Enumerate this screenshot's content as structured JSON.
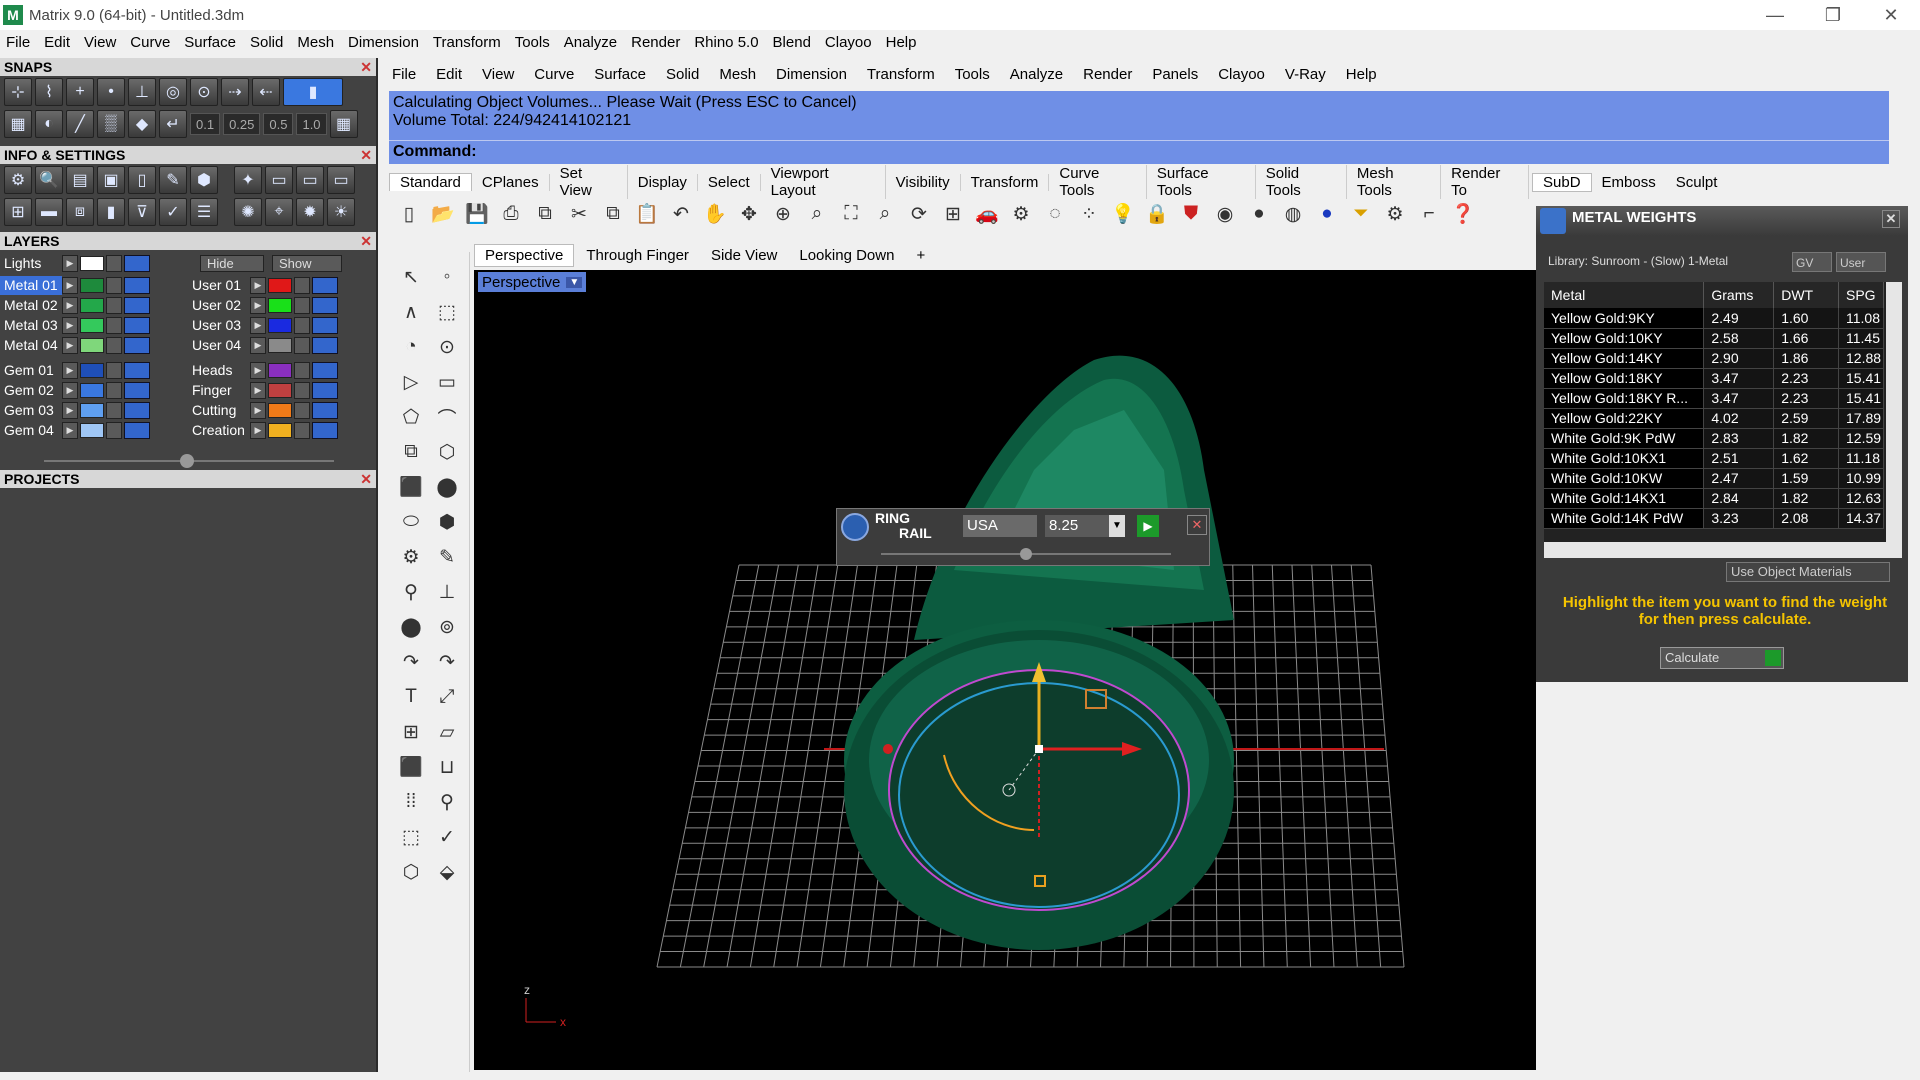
{
  "window": {
    "title": "Matrix 9.0 (64-bit) - Untitled.3dm"
  },
  "main_menu": [
    "File",
    "Edit",
    "View",
    "Curve",
    "Surface",
    "Solid",
    "Mesh",
    "Dimension",
    "Transform",
    "Tools",
    "Analyze",
    "Render",
    "Rhino 5.0",
    "Blend",
    "Clayoo",
    "Help"
  ],
  "panels": {
    "snaps": "SNAPS",
    "info": "INFO & SETTINGS",
    "layers": "LAYERS",
    "projects": "PROJECTS",
    "snap_values": [
      "0.1",
      "0.25",
      "0.5",
      "1.0"
    ]
  },
  "layers": {
    "lights_label": "Lights",
    "hide_label": "Hide",
    "show_label": "Show",
    "left": [
      {
        "name": "Metal 01",
        "color": "#1e8a3c",
        "selected": true
      },
      {
        "name": "Metal 02",
        "color": "#23a84a",
        "selected": false
      },
      {
        "name": "Metal 03",
        "color": "#34c95c",
        "selected": false
      },
      {
        "name": "Metal 04",
        "color": "#7fd77b",
        "selected": false
      },
      {
        "name": "Gem 01",
        "color": "#1f4fb8",
        "selected": false
      },
      {
        "name": "Gem 02",
        "color": "#3a78e0",
        "selected": false
      },
      {
        "name": "Gem 03",
        "color": "#5f9ff0",
        "selected": false
      },
      {
        "name": "Gem 04",
        "color": "#9fc6f5",
        "selected": false
      }
    ],
    "right": [
      {
        "name": "User 01",
        "color": "#e01818"
      },
      {
        "name": "User 02",
        "color": "#19e019"
      },
      {
        "name": "User 03",
        "color": "#1a2ae0"
      },
      {
        "name": "User 04",
        "color": "#8a8a8a"
      },
      {
        "name": "Heads",
        "color": "#8a2fc0"
      },
      {
        "name": "Finger",
        "color": "#c04040"
      },
      {
        "name": "Cutting",
        "color": "#f07a18"
      },
      {
        "name": "Creation",
        "color": "#f0b020"
      }
    ]
  },
  "rhino_menu": [
    "File",
    "Edit",
    "View",
    "Curve",
    "Surface",
    "Solid",
    "Mesh",
    "Dimension",
    "Transform",
    "Tools",
    "Analyze",
    "Render",
    "Panels",
    "Clayoo",
    "V-Ray",
    "Help"
  ],
  "command": {
    "line1": "Calculating Object Volumes... Please Wait (Press ESC to Cancel)",
    "line2": "Volume Total: 224/942414102121",
    "prompt": "Command:"
  },
  "toolbar_tabs": [
    "Standard",
    "CPlanes",
    "Set View",
    "Display",
    "Select",
    "Viewport Layout",
    "Visibility",
    "Transform",
    "Curve Tools",
    "Surface Tools",
    "Solid Tools",
    "Mesh Tools",
    "Render To"
  ],
  "viewport": {
    "tabs": [
      "Perspective",
      "Through Finger",
      "Side View",
      "Looking Down"
    ],
    "active_label": "Perspective"
  },
  "ring_rail": {
    "title_line1": "RING",
    "title_line2": "RAIL",
    "standard": "USA",
    "size": "8.25"
  },
  "right_tabs": [
    "SubD",
    "Emboss",
    "Sculpt"
  ],
  "metal_weights": {
    "title": "METAL WEIGHTS",
    "library": "Library: Sunroom - (Slow) 1-Metal",
    "gv_label": "GV",
    "user_label": "User",
    "columns": [
      "Metal",
      "Grams",
      "DWT",
      "SPG"
    ],
    "rows": [
      [
        "Yellow Gold:9KY",
        "2.49",
        "1.60",
        "11.08"
      ],
      [
        "Yellow Gold:10KY",
        "2.58",
        "1.66",
        "11.45"
      ],
      [
        "Yellow Gold:14KY",
        "2.90",
        "1.86",
        "12.88"
      ],
      [
        "Yellow Gold:18KY",
        "3.47",
        "2.23",
        "15.41"
      ],
      [
        "Yellow Gold:18KY R...",
        "3.47",
        "2.23",
        "15.41"
      ],
      [
        "Yellow Gold:22KY",
        "4.02",
        "2.59",
        "17.89"
      ],
      [
        "White Gold:9K PdW",
        "2.83",
        "1.82",
        "12.59"
      ],
      [
        "White Gold:10KX1",
        "2.51",
        "1.62",
        "11.18"
      ],
      [
        "White Gold:10KW",
        "2.47",
        "1.59",
        "10.99"
      ],
      [
        "White Gold:14KX1",
        "2.84",
        "1.82",
        "12.63"
      ],
      [
        "White Gold:14K PdW",
        "3.23",
        "2.08",
        "14.37"
      ]
    ],
    "use_object_materials": "Use Object Materials",
    "hint": "Highlight the item you want to find the weight for then press calculate.",
    "calculate": "Calculate"
  }
}
